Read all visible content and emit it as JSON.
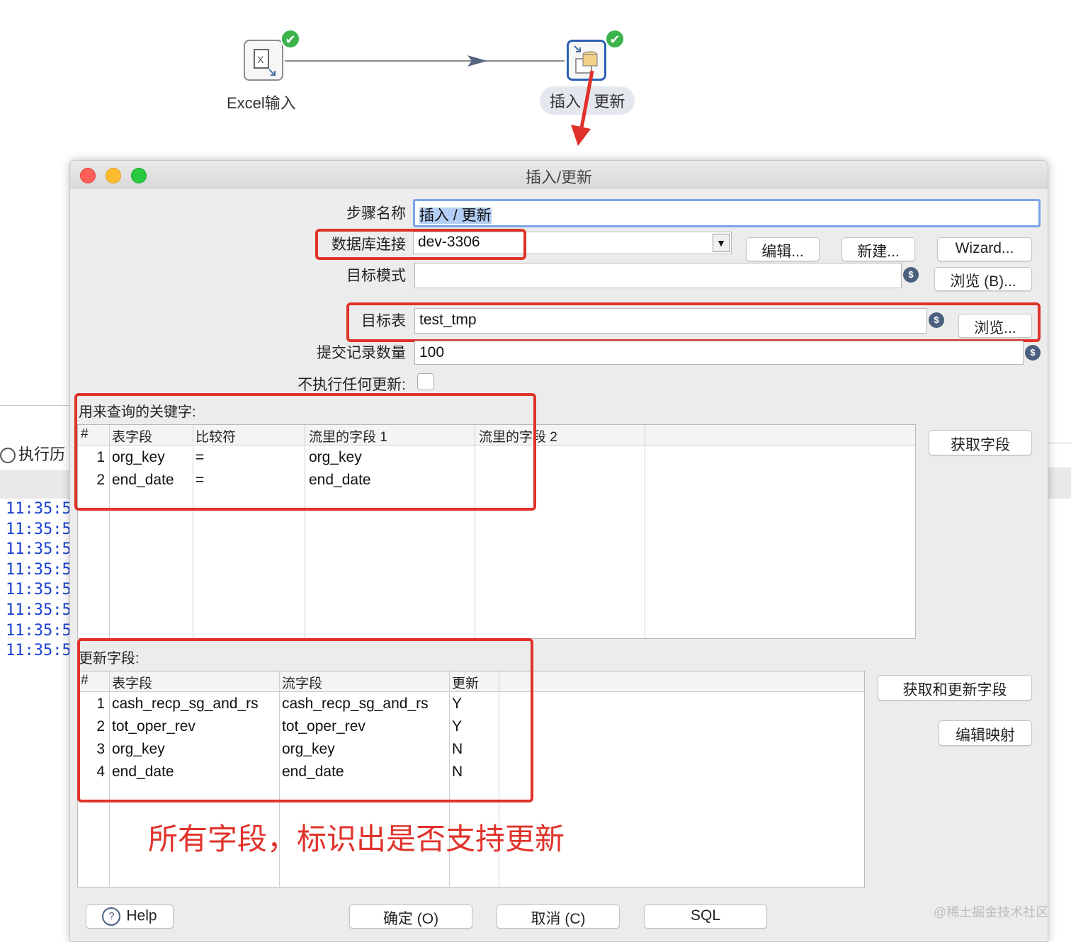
{
  "flow": {
    "node1_label": "Excel输入",
    "node2_label": "插入 / 更新",
    "node1_status": "✔",
    "node2_status": "✔"
  },
  "background": {
    "tab_label": "执行历",
    "times": [
      "11:35:5",
      "11:35:5",
      "11:35:5",
      "11:35:5",
      "11:35:5",
      "11:35:5",
      "11:35:5",
      "11:35:5"
    ]
  },
  "dialog": {
    "title": "插入/更新",
    "step_name_label": "步骤名称",
    "step_name_value": "插入 / 更新",
    "db_conn_label": "数据库连接",
    "db_conn_value": "dev-3306",
    "edit_button": "编辑...",
    "new_button": "新建...",
    "wizard_button": "Wizard...",
    "target_schema_label": "目标模式",
    "target_schema_value": "",
    "browse_b_button": "浏览 (B)...",
    "target_table_label": "目标表",
    "target_table_value": "test_tmp",
    "browse_button": "浏览...",
    "commit_size_label": "提交记录数量",
    "commit_size_value": "100",
    "no_update_label": "不执行任何更新:",
    "key_section_title": "用来查询的关键字:",
    "key_headers": [
      "#",
      "表字段",
      "比较符",
      "流里的字段 1",
      "流里的字段 2"
    ],
    "key_rows": [
      {
        "n": "1",
        "table_field": "org_key",
        "comparator": "=",
        "stream1": "org_key",
        "stream2": ""
      },
      {
        "n": "2",
        "table_field": "end_date",
        "comparator": "=",
        "stream1": "end_date",
        "stream2": ""
      }
    ],
    "get_fields_button": "获取字段",
    "update_section_title": "更新字段:",
    "update_headers": [
      "#",
      "表字段",
      "流字段",
      "更新"
    ],
    "update_rows": [
      {
        "n": "1",
        "table_field": "cash_recp_sg_and_rs",
        "stream_field": "cash_recp_sg_and_rs",
        "update": "Y"
      },
      {
        "n": "2",
        "table_field": "tot_oper_rev",
        "stream_field": "tot_oper_rev",
        "update": "Y"
      },
      {
        "n": "3",
        "table_field": "org_key",
        "stream_field": "org_key",
        "update": "N"
      },
      {
        "n": "4",
        "table_field": "end_date",
        "stream_field": "end_date",
        "update": "N"
      }
    ],
    "get_update_fields_button": "获取和更新字段",
    "edit_mapping_button": "编辑映射",
    "help_button": "Help",
    "ok_button": "确定 (O)",
    "cancel_button": "取消 (C)",
    "sql_button": "SQL"
  },
  "annotation": "所有字段，标识出是否支持更新",
  "watermark": "@稀土掘金技术社区",
  "colors": {
    "highlight_red": "#e0322a",
    "time_blue": "#1740d0",
    "status_green": "#3cb44b"
  }
}
